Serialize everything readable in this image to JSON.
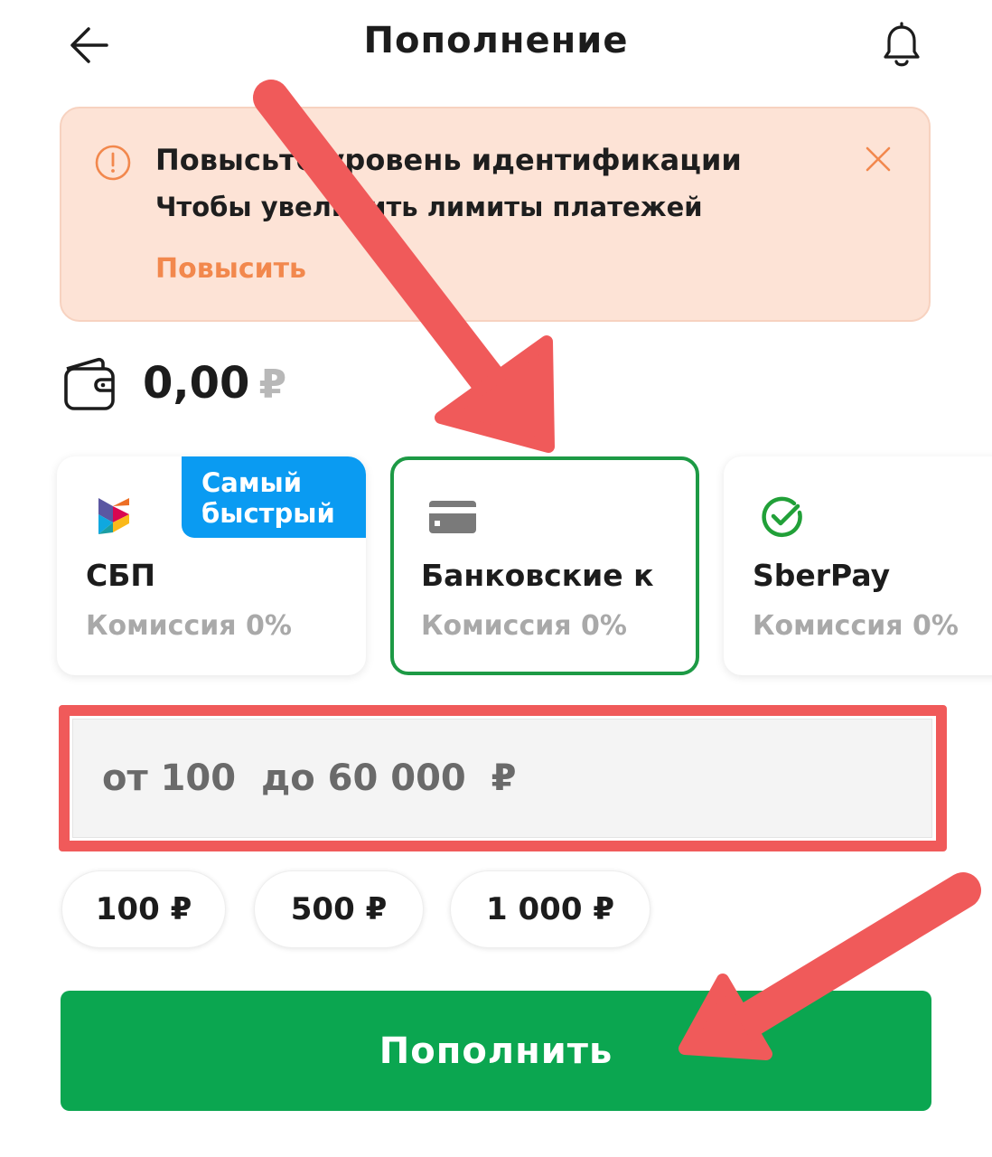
{
  "header": {
    "title": "Пополнение",
    "back_icon": "arrow-left-icon",
    "bell_icon": "bell-icon"
  },
  "banner": {
    "title": "Повысьте уровень идентификации",
    "subtitle": "Чтобы увеличить лимиты платежей",
    "link": "Повысить",
    "info_icon": "exclamation-circle-icon",
    "close_icon": "close-icon",
    "colors": {
      "background": "#fde3d6",
      "accent": "#f2884d"
    }
  },
  "balance": {
    "amount": "0,00",
    "currency": "₽",
    "icon": "wallet-icon"
  },
  "methods": [
    {
      "name": "СБП",
      "fee": "Комиссия 0%",
      "badge": "Самый быстрый",
      "badge_line1": "Самый",
      "badge_line2": "быстрый",
      "icon": "sbp-logo-icon",
      "selected": false
    },
    {
      "name": "Банковские к",
      "fee": "Комиссия 0%",
      "icon": "bank-card-icon",
      "selected": true
    },
    {
      "name": "SberPay",
      "fee": "Комиссия 0%",
      "icon": "sberpay-check-icon",
      "selected": false
    }
  ],
  "amount_input": {
    "placeholder": "от 100  до 60 000  ₽",
    "value": ""
  },
  "chips": [
    {
      "label": "100 ₽"
    },
    {
      "label": "500 ₽"
    },
    {
      "label": "1 000 ₽"
    }
  ],
  "submit": {
    "label": "Пополнить",
    "color": "#0ba650"
  },
  "annotation_color": "#f05a5a"
}
